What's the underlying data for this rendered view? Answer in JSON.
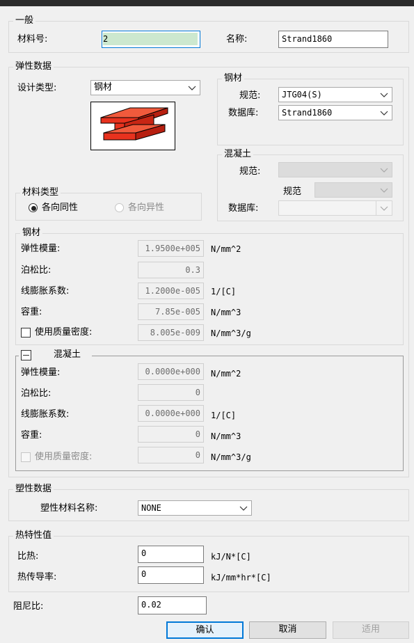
{
  "general": {
    "legend": "一般",
    "material_no_label": "材料号:",
    "material_no_value": "2",
    "name_label": "名称:",
    "name_value": "Strand1860"
  },
  "elastic": {
    "legend": "弹性数据",
    "design_type_label": "设计类型:",
    "design_type_value": "钢材",
    "steel_box": {
      "legend": "钢材",
      "code_label": "规范:",
      "code_value": "JTG04(S)",
      "db_label": "数据库:",
      "db_value": "Strand1860"
    },
    "concrete_box": {
      "legend": "混凝土",
      "code_label": "规范:",
      "code_label_2": "规范",
      "db_label": "数据库:"
    },
    "material_type": {
      "legend": "材料类型",
      "isotropic": "各向同性",
      "anisotropic": "各向异性",
      "selected": "isotropic"
    },
    "steel": {
      "legend": "钢材",
      "rows": [
        {
          "label": "弹性模量:",
          "value": "1.9500e+005",
          "unit": "N/mm^2"
        },
        {
          "label": "泊松比:",
          "value": "0.3",
          "unit": ""
        },
        {
          "label": "线膨胀系数:",
          "value": "1.2000e-005",
          "unit": "1/[C]"
        },
        {
          "label": "容重:",
          "value": "7.85e-005",
          "unit": "N/mm^3"
        },
        {
          "label": "使用质量密度:",
          "value": "8.005e-009",
          "unit": "N/mm^3/g"
        }
      ]
    },
    "concrete": {
      "legend": "混凝土",
      "rows": [
        {
          "label": "弹性模量:",
          "value": "0.0000e+000",
          "unit": "N/mm^2"
        },
        {
          "label": "泊松比:",
          "value": "0",
          "unit": ""
        },
        {
          "label": "线膨胀系数:",
          "value": "0.0000e+000",
          "unit": "1/[C]"
        },
        {
          "label": "容重:",
          "value": "0",
          "unit": "N/mm^3"
        },
        {
          "label": "使用质量密度:",
          "value": "0",
          "unit": "N/mm^3/g"
        }
      ]
    }
  },
  "plastic": {
    "legend": "塑性数据",
    "name_label": "塑性材料名称:",
    "name_value": "NONE"
  },
  "thermal": {
    "legend": "热特性值",
    "specific_heat_label": "比热:",
    "specific_heat_value": "0",
    "specific_heat_unit": "kJ/N*[C]",
    "conductivity_label": "热传导率:",
    "conductivity_value": "0",
    "conductivity_unit": "kJ/mm*hr*[C]"
  },
  "damping": {
    "label": "阻尼比:",
    "value": "0.02"
  },
  "buttons": {
    "ok": "确认",
    "cancel": "取消",
    "apply": "适用"
  },
  "colors": {
    "beam_red": "#e8321e",
    "selection_highlight": "#cce8cf",
    "focus_blue": "#0078d7"
  }
}
